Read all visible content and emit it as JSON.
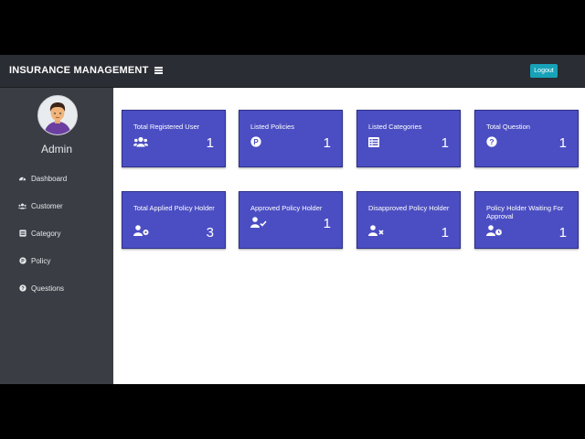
{
  "header": {
    "title": "INSURANCE MANAGEMENT",
    "logout_label": "Logout"
  },
  "sidebar": {
    "user_name": "Admin",
    "items": [
      {
        "label": "Dashboard",
        "icon": "tachometer-icon"
      },
      {
        "label": "Customer",
        "icon": "users-icon"
      },
      {
        "label": "Category",
        "icon": "list-icon"
      },
      {
        "label": "Policy",
        "icon": "p-circle-icon"
      },
      {
        "label": "Questions",
        "icon": "question-circle-icon"
      }
    ]
  },
  "cards": [
    {
      "title": "Total Registered User",
      "value": "1",
      "icon": "users-icon"
    },
    {
      "title": "Listed Policies",
      "value": "1",
      "icon": "p-circle-icon"
    },
    {
      "title": "Listed Categories",
      "value": "1",
      "icon": "list-icon"
    },
    {
      "title": "Total Question",
      "value": "1",
      "icon": "question-circle-icon"
    },
    {
      "title": "Total Applied Policy Holder",
      "value": "3",
      "icon": "user-gear-icon"
    },
    {
      "title": "Approved Policy Holder",
      "value": "1",
      "icon": "user-check-icon"
    },
    {
      "title": "Disapproved Policy Holder",
      "value": "1",
      "icon": "user-x-icon"
    },
    {
      "title": "Policy Holder Waiting For Approval",
      "value": "1",
      "icon": "user-clock-icon"
    }
  ],
  "colors": {
    "topbar": "#2a2d33",
    "sidebar": "#3a3d44",
    "card": "#4b4ec2",
    "logout": "#17a2b8"
  }
}
